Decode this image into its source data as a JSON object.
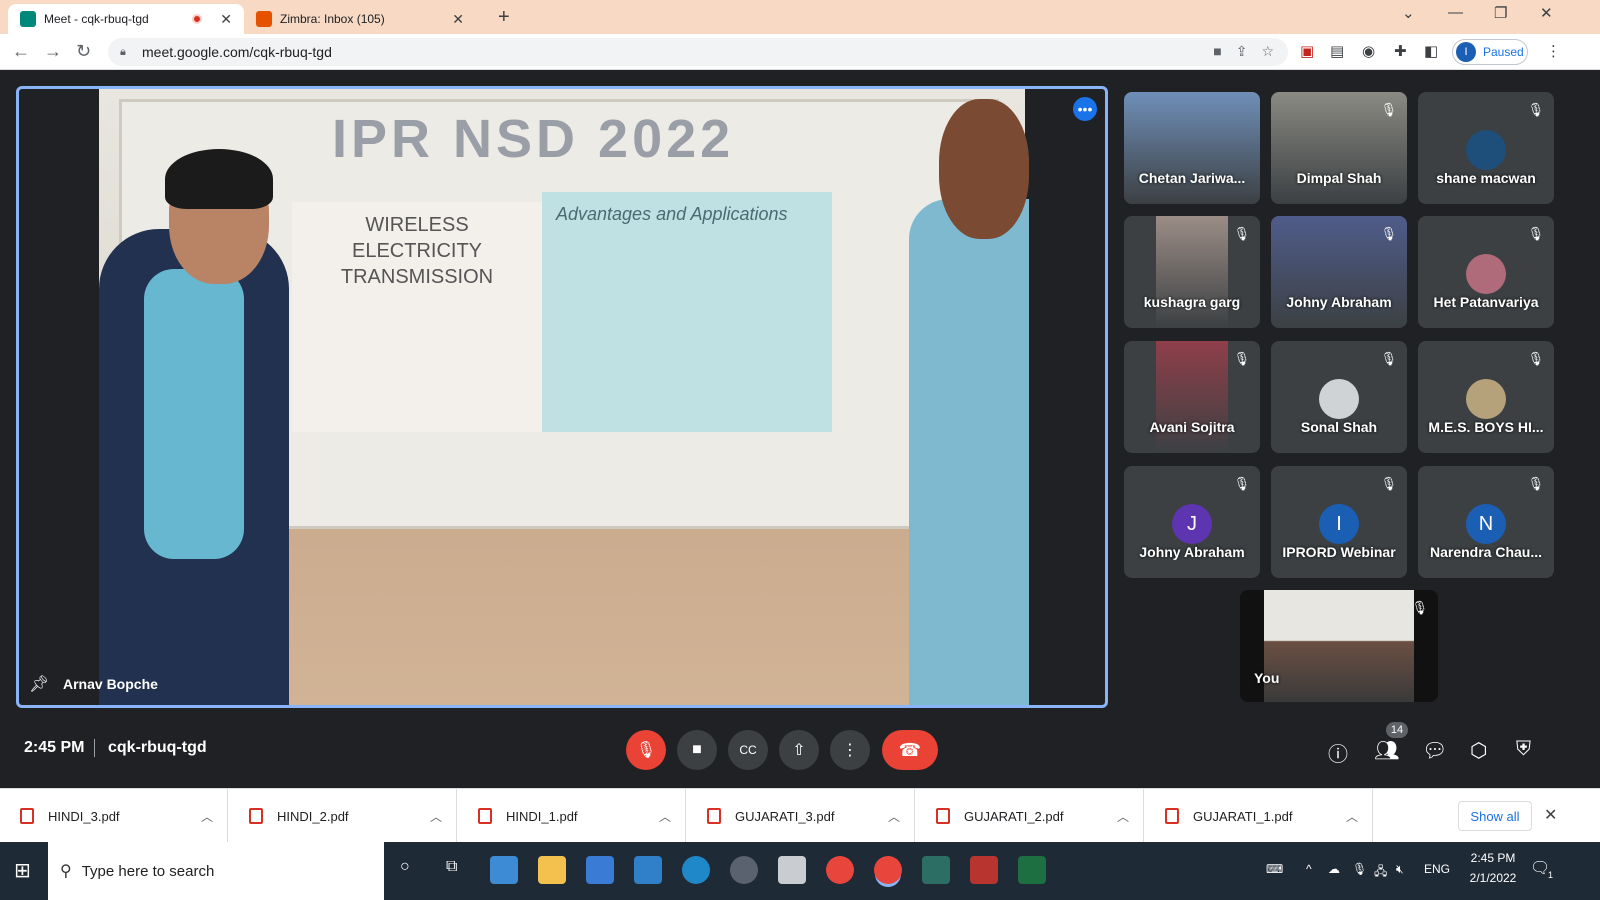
{
  "browser": {
    "tabs": [
      {
        "title": "Meet - cqk-rbuq-tgd",
        "active": true,
        "recording": true
      },
      {
        "title": "Zimbra: Inbox (105)",
        "active": false
      }
    ],
    "url": "meet.google.com/cqk-rbuq-tgd",
    "profile_initial": "I",
    "profile_status": "Paused"
  },
  "meet": {
    "presenter_name": "Arnav Bopche",
    "board_title": "IPR NSD 2022",
    "poster1_text": "WIRELESS ELECTRICITY TRANSMISSION",
    "poster2_text": "Advantages and Applications",
    "time": "2:45 PM",
    "meeting_code": "cqk-rbuq-tgd",
    "people_count": "14",
    "participants": [
      {
        "name": "Chetan Jariwa...",
        "type": "photo",
        "color": "#6f8fb8"
      },
      {
        "name": "Dimpal Shah",
        "type": "photo",
        "color": "#8a8a83"
      },
      {
        "name": "shane macwan",
        "type": "avatar-photo",
        "color": "#1d4f7a"
      },
      {
        "name": "kushagra garg",
        "type": "photo",
        "color": "#9b8d86"
      },
      {
        "name": "Johny Abraham",
        "type": "photo",
        "color": "#4f5c8a"
      },
      {
        "name": "Het Patanvariya",
        "type": "avatar-photo",
        "color": "#b06b7b"
      },
      {
        "name": "Avani Sojitra",
        "type": "photo",
        "color": "#8f3f4a"
      },
      {
        "name": "Sonal Shah",
        "type": "avatar-photo",
        "color": "#cfd3d6"
      },
      {
        "name": "M.E.S. BOYS HI...",
        "type": "avatar-photo",
        "color": "#b5a17a"
      },
      {
        "name": "Johny Abraham",
        "type": "letter",
        "letter": "J",
        "color": "#5e35b1"
      },
      {
        "name": "IPRORD Webinar",
        "type": "letter",
        "letter": "I",
        "color": "#1a5fb4"
      },
      {
        "name": "Narendra Chau...",
        "type": "letter",
        "letter": "N",
        "color": "#1a5fb4"
      }
    ],
    "self_label": "You"
  },
  "downloads": {
    "files": [
      "HINDI_3.pdf",
      "HINDI_2.pdf",
      "HINDI_1.pdf",
      "GUJARATI_3.pdf",
      "GUJARATI_2.pdf",
      "GUJARATI_1.pdf"
    ],
    "show_all": "Show all"
  },
  "taskbar": {
    "search_placeholder": "Type here to search",
    "lang": "ENG",
    "time": "2:45 PM",
    "date": "2/1/2022",
    "notif_count": "1"
  }
}
